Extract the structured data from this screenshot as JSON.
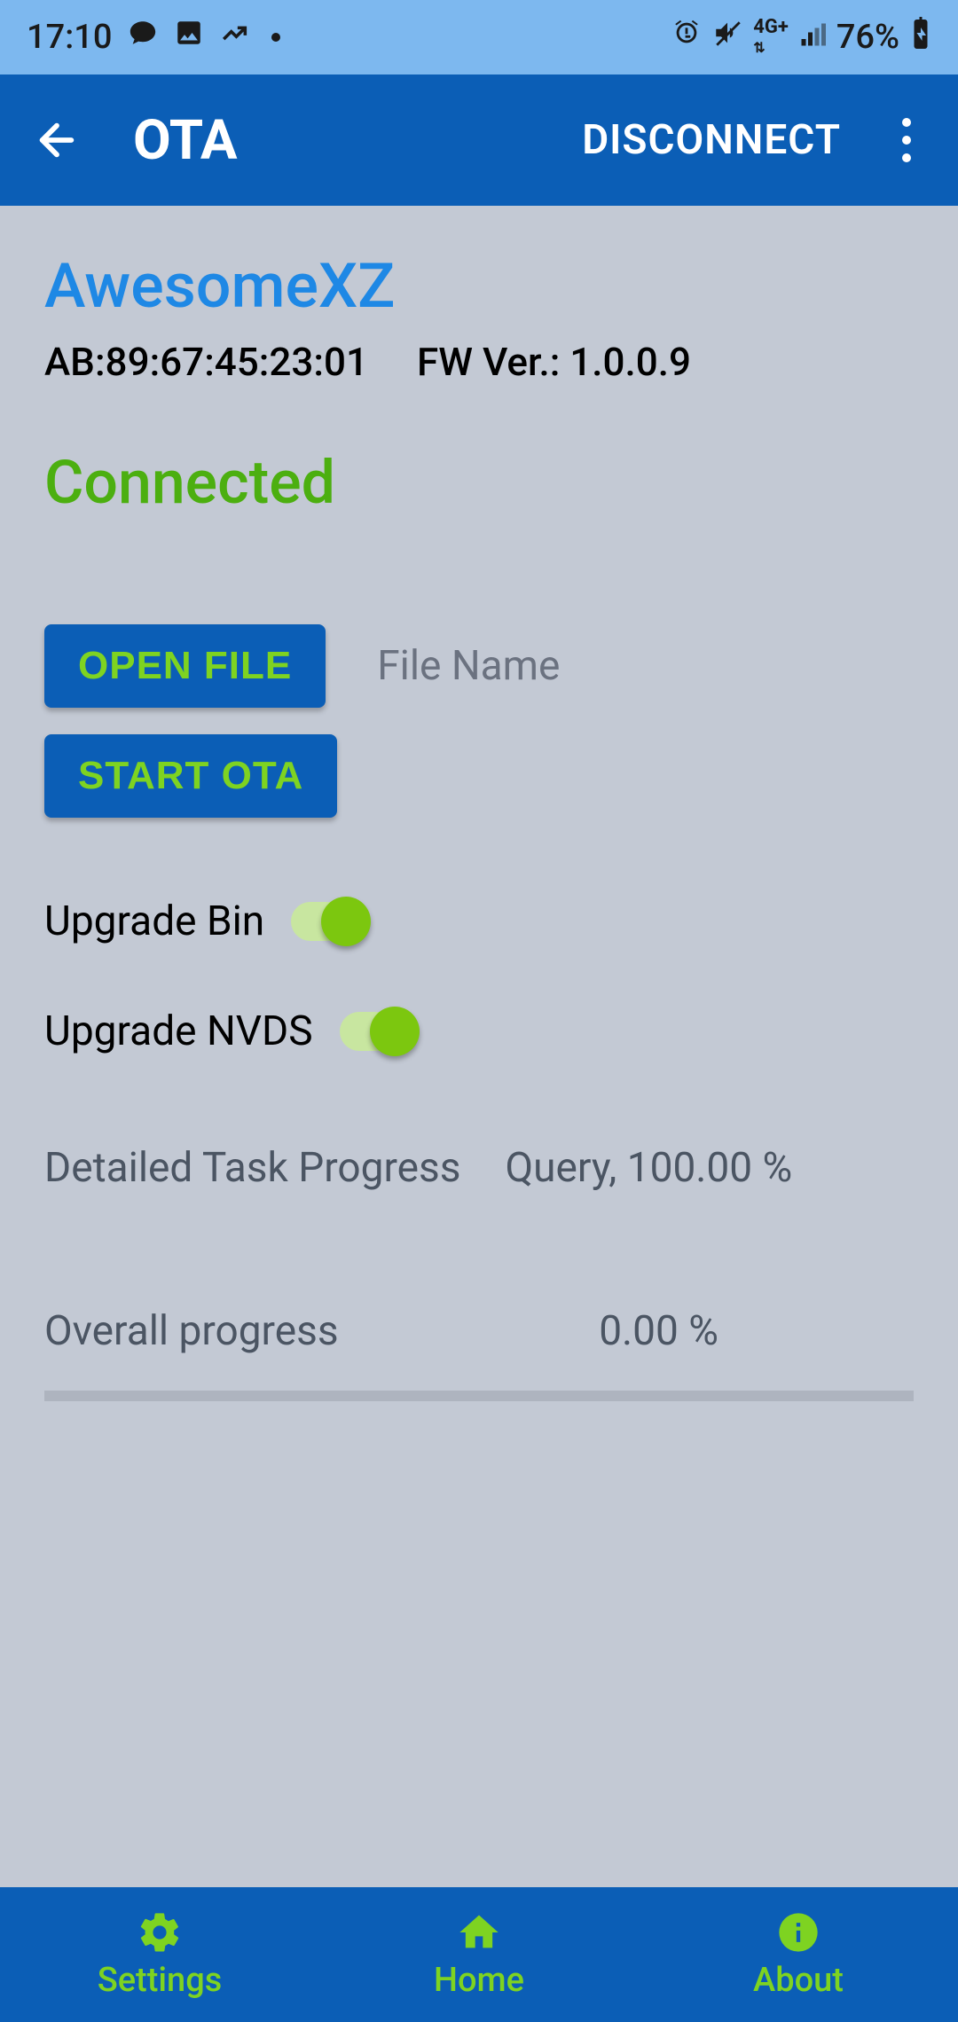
{
  "statusbar": {
    "time": "17:10",
    "battery": "76%"
  },
  "appbar": {
    "title": "OTA",
    "disconnect_label": "DISCONNECT"
  },
  "device": {
    "name": "AwesomeXZ",
    "mac": "AB:89:67:45:23:01",
    "fw_label": "FW Ver.: 1.0.0.9",
    "status": "Connected"
  },
  "buttons": {
    "open_file": "OPEN FILE",
    "start_ota": "START OTA"
  },
  "file": {
    "name_placeholder": "File Name"
  },
  "toggles": {
    "upgrade_bin_label": "Upgrade Bin",
    "upgrade_bin_on": true,
    "upgrade_nvds_label": "Upgrade NVDS",
    "upgrade_nvds_on": true
  },
  "progress": {
    "detail_label": "Detailed Task Progress",
    "detail_value": "Query, 100.00 %",
    "overall_label": "Overall progress",
    "overall_value": "0.00 %",
    "overall_percent": 0
  },
  "nav": {
    "settings": "Settings",
    "home": "Home",
    "about": "About"
  }
}
